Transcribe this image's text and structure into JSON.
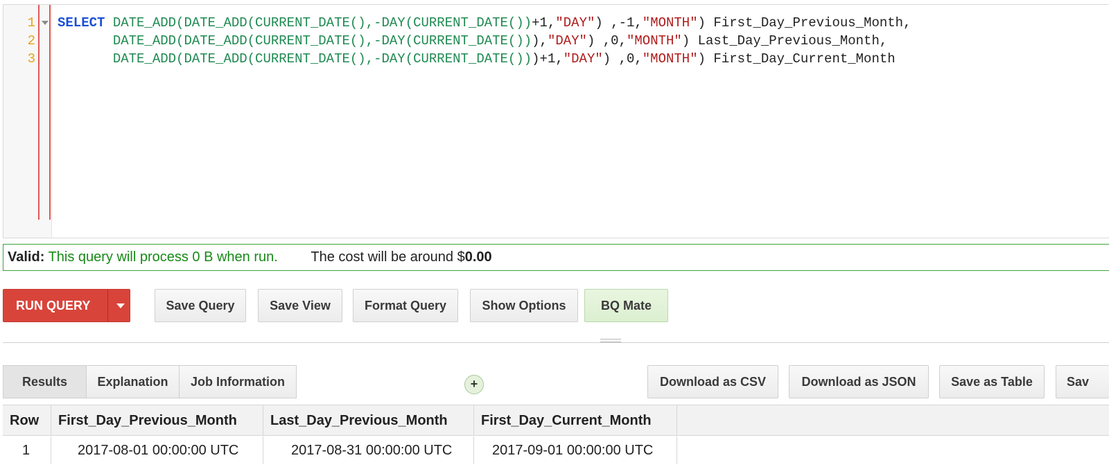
{
  "editor": {
    "line_numbers": [
      "1",
      "2",
      "3"
    ],
    "lines": [
      [
        {
          "t": "kw",
          "v": "SELECT"
        },
        {
          "t": "pl",
          "v": " "
        },
        {
          "t": "fn",
          "v": "DATE_ADD(DATE_ADD(CURRENT_DATE(),-DAY(CURRENT_DATE())"
        },
        {
          "t": "pl",
          "v": "+1,"
        },
        {
          "t": "str",
          "v": "\"DAY\""
        },
        {
          "t": "pl",
          "v": ") ,-1,"
        },
        {
          "t": "str",
          "v": "\"MONTH\""
        },
        {
          "t": "pl",
          "v": ") First_Day_Previous_Month,"
        }
      ],
      [
        {
          "t": "pl",
          "v": "       "
        },
        {
          "t": "fn",
          "v": "DATE_ADD(DATE_ADD(CURRENT_DATE(),-DAY(CURRENT_DATE())"
        },
        {
          "t": "pl",
          "v": "),"
        },
        {
          "t": "str",
          "v": "\"DAY\""
        },
        {
          "t": "pl",
          "v": ") ,0,"
        },
        {
          "t": "str",
          "v": "\"MONTH\""
        },
        {
          "t": "pl",
          "v": ") Last_Day_Previous_Month,"
        }
      ],
      [
        {
          "t": "pl",
          "v": "       "
        },
        {
          "t": "fn",
          "v": "DATE_ADD(DATE_ADD(CURRENT_DATE(),-DAY(CURRENT_DATE())"
        },
        {
          "t": "pl",
          "v": ")+1,"
        },
        {
          "t": "str",
          "v": "\"DAY\""
        },
        {
          "t": "pl",
          "v": ") ,0,"
        },
        {
          "t": "str",
          "v": "\"MONTH\""
        },
        {
          "t": "pl",
          "v": ") First_Day_Current_Month"
        }
      ]
    ]
  },
  "validation": {
    "label": "Valid:",
    "message": "This query will process 0 B when run.",
    "cost_prefix": "The cost will be around $",
    "cost_amount": "0.00"
  },
  "toolbar": {
    "run_label": "RUN QUERY",
    "save_query": "Save Query",
    "save_view": "Save View",
    "format_query": "Format Query",
    "show_options": "Show Options",
    "bq_mate": "BQ Mate"
  },
  "results": {
    "tabs": [
      "Results",
      "Explanation",
      "Job Information"
    ],
    "active_tab": "Results",
    "add_label": "+",
    "download_csv": "Download as CSV",
    "download_json": "Download as JSON",
    "save_table": "Save as Table",
    "save_more": "Sav"
  },
  "table": {
    "columns": [
      "Row",
      "First_Day_Previous_Month",
      "Last_Day_Previous_Month",
      "First_Day_Current_Month"
    ],
    "rows": [
      [
        "1",
        "2017-08-01 00:00:00 UTC",
        "2017-08-31 00:00:00 UTC",
        "2017-09-01 00:00:00 UTC"
      ]
    ]
  },
  "colors": {
    "run_button": "#d8443a",
    "valid_border": "#3aa33a",
    "keyword": "#1a4fd6",
    "function": "#1f8a52",
    "string": "#b01c1c",
    "line_number": "#e8a21a"
  },
  "icons": {
    "run_dropdown": "caret-down-icon",
    "fold": "fold-arrow-icon",
    "add": "plus-icon",
    "resize": "drag-handle-icon"
  }
}
